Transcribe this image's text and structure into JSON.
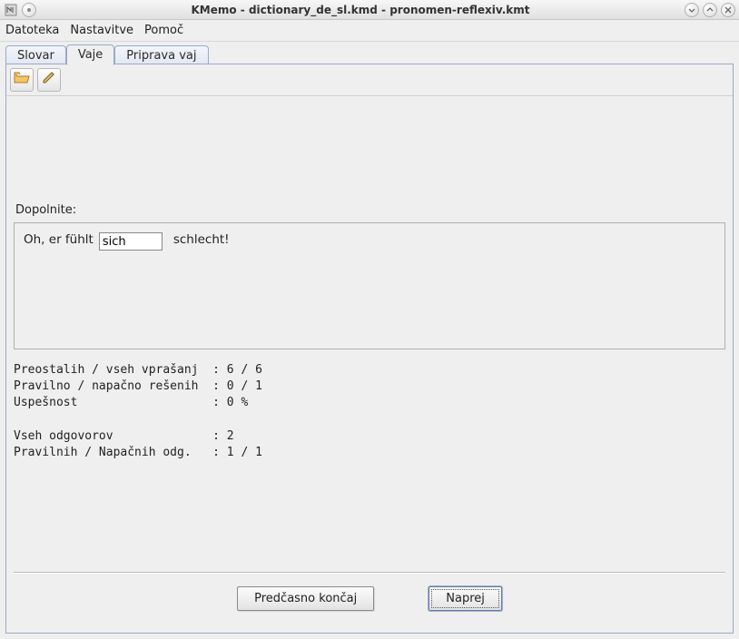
{
  "titlebar": {
    "title": "KMemo  -  dictionary_de_sl.kmd  -  pronomen-reflexiv.kmt"
  },
  "menu": {
    "file": "Datoteka",
    "settings": "Nastavitve",
    "help": "Pomoč"
  },
  "tabs": {
    "dictionary": "Slovar",
    "exercises": "Vaje",
    "prepare": "Priprava vaj"
  },
  "toolbar_icons": {
    "open": "open-icon",
    "edit": "edit-icon"
  },
  "exercise": {
    "prompt": "Dopolnite:",
    "before": "Oh, er fühlt",
    "answer_value": "sich",
    "after": "schlecht!"
  },
  "stats": {
    "line1": "Preostalih / vseh vprašanj  : 6 / 6",
    "line2": "Pravilno / napačno rešenih  : 0 / 1",
    "line3": "Uspešnost                   : 0 %",
    "line4": "Vseh odgovorov              : 2",
    "line5": "Pravilnih / Napačnih odg.   : 1 / 1"
  },
  "buttons": {
    "finish_early": "Predčasno končaj",
    "next": "Naprej"
  }
}
